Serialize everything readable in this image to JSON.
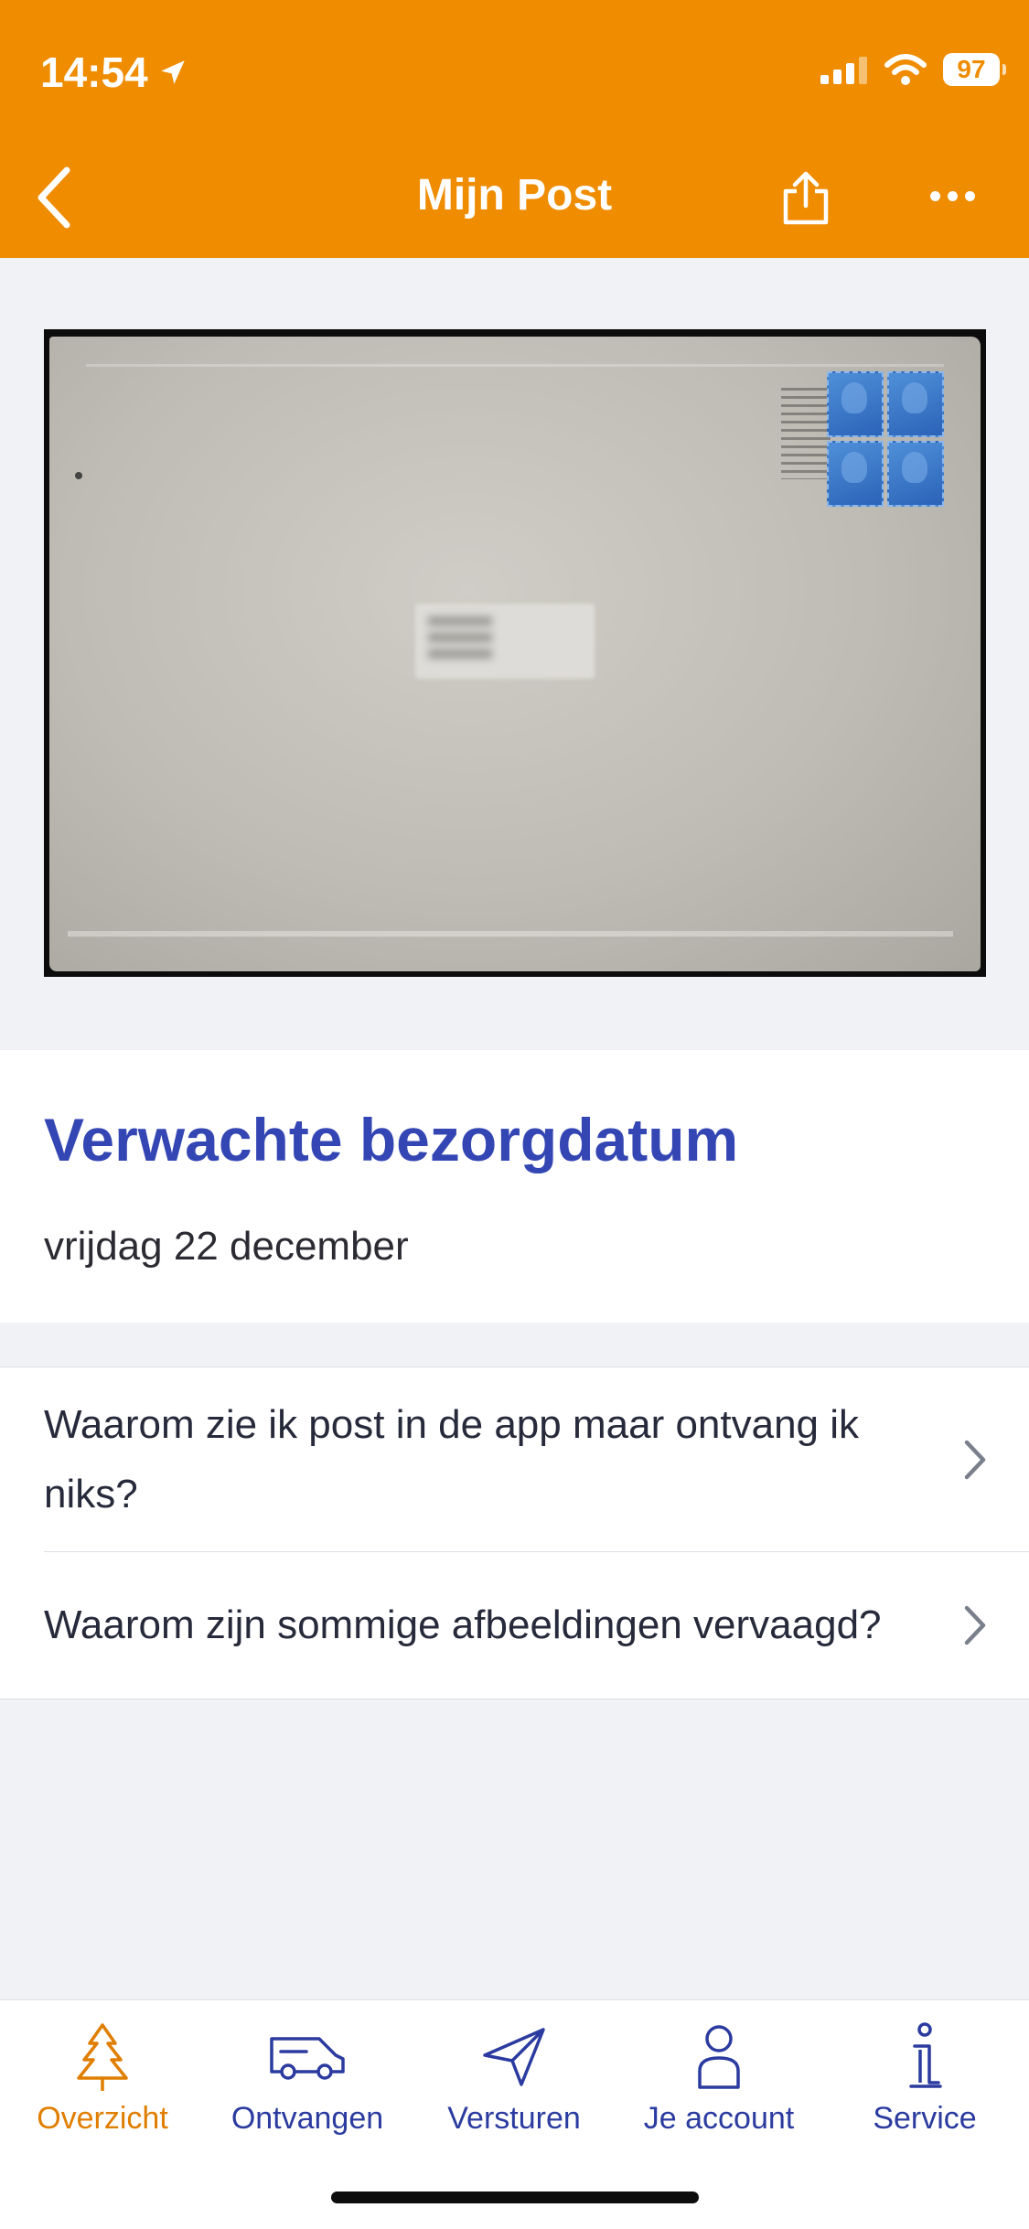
{
  "status_bar": {
    "time": "14:54",
    "battery": "97"
  },
  "header": {
    "title": "Mijn Post"
  },
  "delivery": {
    "heading": "Verwachte bezorgdatum",
    "date": "vrijdag 22 december"
  },
  "faq": [
    {
      "label": "Waarom zie ik post in de app maar ontvang ik niks?"
    },
    {
      "label": "Waarom zijn sommige afbeeldingen vervaagd?"
    }
  ],
  "tabbar": {
    "tabs": [
      {
        "label": "Overzicht",
        "icon": "tree-icon",
        "active": true
      },
      {
        "label": "Ontvangen",
        "icon": "van-icon",
        "active": false
      },
      {
        "label": "Versturen",
        "icon": "paper-plane-icon",
        "active": false
      },
      {
        "label": "Je account",
        "icon": "person-icon",
        "active": false
      },
      {
        "label": "Service",
        "icon": "info-icon",
        "active": false
      }
    ]
  },
  "colors": {
    "brand_orange": "#ef8c00",
    "heading_blue": "#3446b3",
    "tab_blue": "#2b3b9f",
    "active_tab": "#e07e00"
  }
}
